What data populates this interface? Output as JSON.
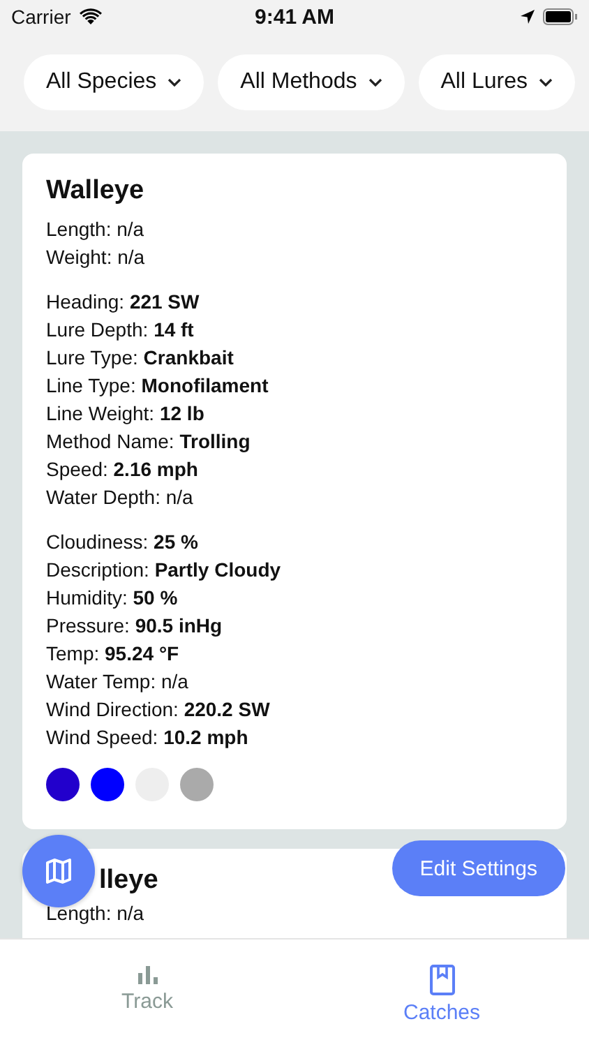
{
  "status_bar": {
    "carrier": "Carrier",
    "time": "9:41 AM"
  },
  "filters": [
    {
      "label": "All Species"
    },
    {
      "label": "All Methods"
    },
    {
      "label": "All Lures"
    }
  ],
  "cards": [
    {
      "title": "Walleye",
      "groups": [
        [
          "Length: n/a",
          "Weight: n/a"
        ],
        [
          "Heading: **221 SW**",
          "Lure Depth: **14 ft**",
          "Lure Type: **Crankbait**",
          "Line Type: **Monofilament**",
          "Line Weight: **12 lb**",
          "Method Name: **Trolling**",
          "Speed: **2.16 mph**",
          "Water Depth: n/a"
        ],
        [
          "Cloudiness: **25 %**",
          "Description: **Partly Cloudy**",
          "Humidity: **50 %**",
          "Pressure: **90.5 inHg**",
          "Temp: **95.24 °F**",
          "Water Temp: n/a",
          "Wind Direction: **220.2 SW**",
          "Wind Speed: **10.2 mph**"
        ]
      ],
      "dots": [
        {
          "color": "#2200cc"
        },
        {
          "color": "#0000ff"
        },
        {
          "color": "#eeeeee"
        },
        {
          "color": "#aaaaaa"
        }
      ]
    },
    {
      "title": "lleye",
      "groups": [
        [
          "Length: n/a"
        ]
      ]
    }
  ],
  "edit_button": "Edit Settings",
  "tabs": [
    {
      "label": "Track",
      "kind": "chart",
      "selected": false
    },
    {
      "label": "Catches",
      "kind": "book",
      "selected": true
    }
  ]
}
